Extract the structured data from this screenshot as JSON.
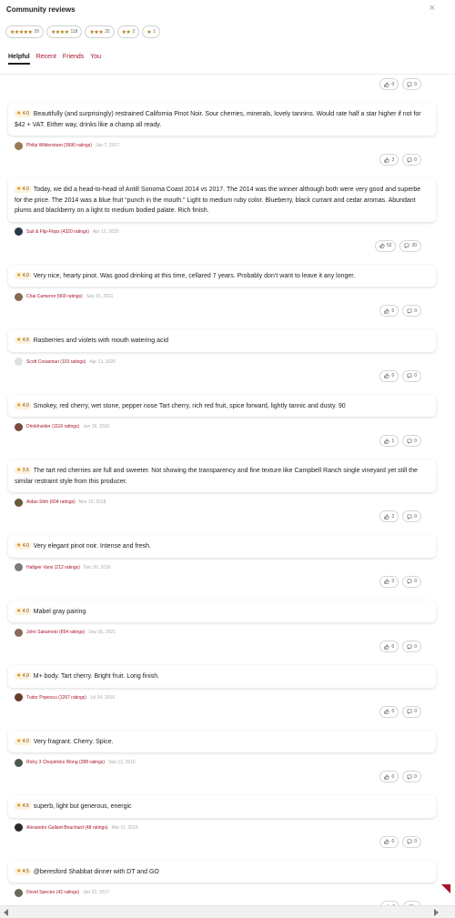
{
  "header": {
    "title": "Community reviews",
    "close_label": "×"
  },
  "filters": [
    {
      "stars": "★★★★★",
      "count": "29"
    },
    {
      "stars": "★★★★",
      "count": "118"
    },
    {
      "stars": "★★★",
      "count": "25"
    },
    {
      "stars": "★★",
      "count": "2"
    },
    {
      "stars": "★",
      "count": "1"
    }
  ],
  "tabs": [
    "Helpful",
    "Recent",
    "Friends",
    "You"
  ],
  "top_actions": {
    "likes": "0",
    "comments": "0"
  },
  "reviews": [
    {
      "rating": "4.0",
      "text": "Beautifully (and surprisingly) restrained California Pinot Noir. Sour cherries, minerals, lovely tannins. Would rate half a star higher if not for $42 + VAT. Either way, drinks like a champ all ready.",
      "user": "Philip Wildenstam (3690 ratings)",
      "date": "Jan 7, 2017",
      "likes": "3",
      "comments": "0",
      "avatar_color": "#9a7a55"
    },
    {
      "rating": "4.0",
      "text": "Today, we did a head-to-head of Antill Sonoma Coast 2014 vs 2017. The 2014 was the winner although both were very good and superbe for the price. The 2014 was a blue fruit “punch in the mouth.” Light to medium ruby color. Blueberry, black currant and cedar aromas. Abundant plums and blackberry on a light to medium bodied palate. Rich finish.",
      "user": "Suit & Flip-Flops (4320 ratings)",
      "date": "Apr 12, 2020",
      "likes": "52",
      "comments": "20",
      "avatar_color": "#2a3a4a"
    },
    {
      "rating": "4.0",
      "text": "Very nice, hearty pinot. Was good drinking at this time, cellared 7 years. Probably don’t want to leave it any longer.",
      "user": "Chai Cameron (969 ratings)",
      "date": "Sep 15, 2021",
      "likes": "0",
      "comments": "0",
      "avatar_color": "#8a6a50"
    },
    {
      "rating": "4.5",
      "text": "Rasberries and violets with mouth watering acid",
      "user": "Scott Creasman (103 ratings)",
      "date": "Apr 13, 2020",
      "likes": "0",
      "comments": "0",
      "avatar_color": "#e0e0e0"
    },
    {
      "rating": "4.0",
      "text": "Smokey, red cherry, wet stone, pepper nose Tart cherry, rich red fruit, spice forward, lightly tannic and dusty. 90",
      "user": "DrinkInsider (1116 ratings)",
      "date": "Jun 18, 2016",
      "likes": "1",
      "comments": "0",
      "avatar_color": "#7a4a3a"
    },
    {
      "rating": "3.5",
      "text": "The tart red cherries are full and sweeter. Not showing the transparency and fine texture like Campbell Ranch single vineyard yet still the similar restraint style from this producer.",
      "user": "Aidan Shih (604 ratings)",
      "date": "Nov 10, 2018",
      "likes": "2",
      "comments": "0",
      "avatar_color": "#6a5a3a"
    },
    {
      "rating": "4.0",
      "text": "Very elegant pinot noir. Intense and fresh.",
      "user": "Hallgeir Varsi (212 ratings)",
      "date": "Dec 30, 2016",
      "likes": "0",
      "comments": "0",
      "avatar_color": "#7a7a7a"
    },
    {
      "rating": "4.0",
      "text": "Mabel gray pairing",
      "user": "John Sakamoto (854 ratings)",
      "date": "Sep 26, 2021",
      "likes": "0",
      "comments": "0",
      "avatar_color": "#8a6a5a"
    },
    {
      "rating": "4.0",
      "text": "M+ body. Tart cherry. Bright fruit. Long finish.",
      "user": "Tudor Popescu (1267 ratings)",
      "date": "Jul 24, 2016",
      "likes": "0",
      "comments": "0",
      "avatar_color": "#6a3a2a"
    },
    {
      "rating": "4.0",
      "text": "Very fragrant. Cherry. Spice.",
      "user": "Ricky 3 Chopsticks Wong (288 ratings)",
      "date": "Sep 12, 2016",
      "likes": "0",
      "comments": "0",
      "avatar_color": "#4a5a4a"
    },
    {
      "rating": "4.5",
      "text": "superb, light but generous, energic",
      "user": "Alexandre Gallant-Bouchard (48 ratings)",
      "date": "Mar 11, 2019",
      "likes": "0",
      "comments": "0",
      "avatar_color": "#2a2a2a"
    },
    {
      "rating": "4.5",
      "text": "@beresford Shabbat dinner with DT and GO",
      "user": "Dovid Spector (42 ratings)",
      "date": "Jan 22, 2017",
      "likes": "0",
      "comments": "",
      "avatar_color": "#6a6a5a"
    }
  ],
  "colors": {
    "accent": "#a8122a",
    "star": "#d48a0a",
    "badge_bg": "#fdf2dd"
  },
  "icons": {
    "like": "thumbs-up-icon",
    "comment": "speech-bubble-icon",
    "close": "close-icon",
    "star": "star-icon"
  }
}
